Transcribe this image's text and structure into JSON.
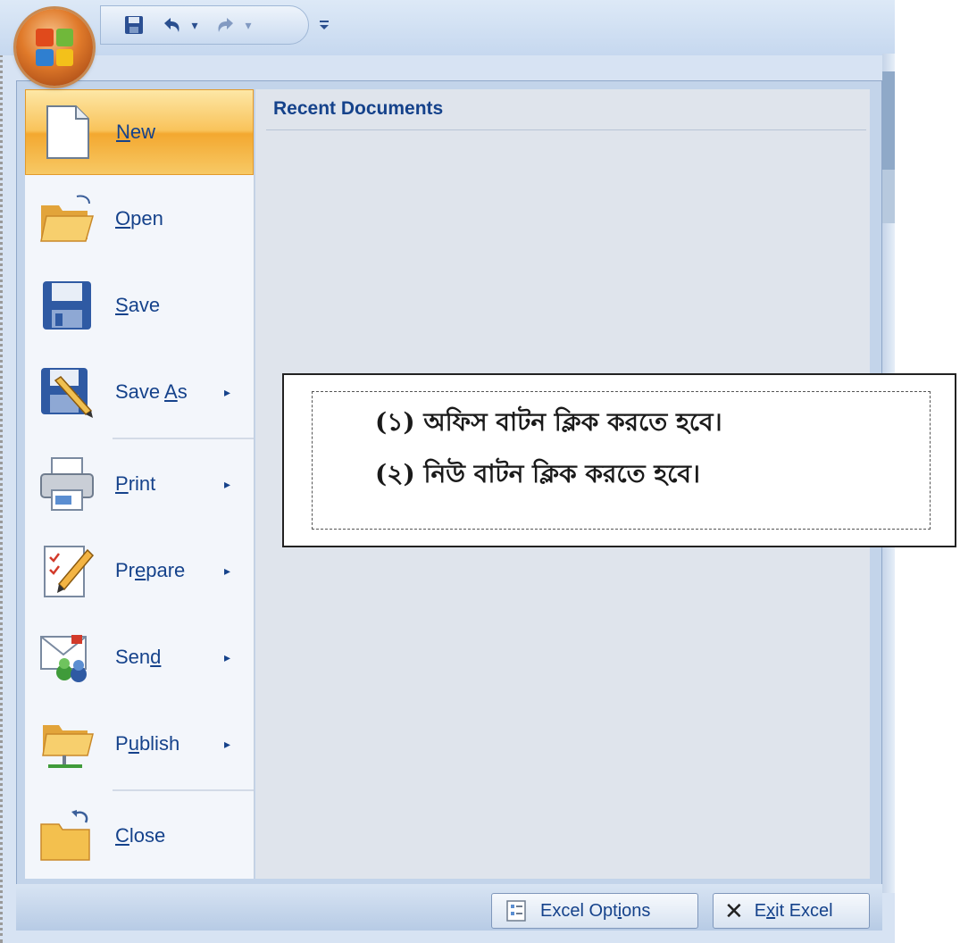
{
  "menu": {
    "items": [
      {
        "label_pre": "",
        "label_u": "N",
        "label_post": "ew",
        "has_submenu": false
      },
      {
        "label_pre": "",
        "label_u": "O",
        "label_post": "pen",
        "has_submenu": false
      },
      {
        "label_pre": "",
        "label_u": "S",
        "label_post": "ave",
        "has_submenu": false
      },
      {
        "label_pre": "Save ",
        "label_u": "A",
        "label_post": "s",
        "has_submenu": true
      },
      {
        "label_pre": "",
        "label_u": "P",
        "label_post": "rint",
        "has_submenu": true
      },
      {
        "label_pre": "Pr",
        "label_u": "e",
        "label_post": "pare",
        "has_submenu": true
      },
      {
        "label_pre": "Sen",
        "label_u": "d",
        "label_post": "",
        "has_submenu": true
      },
      {
        "label_pre": "P",
        "label_u": "u",
        "label_post": "blish",
        "has_submenu": true
      },
      {
        "label_pre": "",
        "label_u": "C",
        "label_post": "lose",
        "has_submenu": false
      }
    ],
    "submenu_arrow": "▸"
  },
  "recent": {
    "title": "Recent Documents"
  },
  "bottom": {
    "options": {
      "pre": "Excel Opt",
      "u": "i",
      "post": "ons"
    },
    "exit": {
      "pre": "E",
      "u": "x",
      "post": "it Excel",
      "icon": "✕"
    }
  },
  "qat": {
    "save_icon": "save-icon",
    "undo_icon": "undo-icon",
    "redo_icon": "redo-icon",
    "customize_icon": "customize-icon"
  },
  "note": {
    "line1": "(১)  অফিস বাটন ক্লিক করতে হবে।",
    "line2": "(২)  নিউ বাটন ক্লিক করতে হবে।"
  },
  "colors": {
    "accent": "#15428b",
    "selected": "#f9c35a",
    "office_button": "#e07a2a"
  }
}
